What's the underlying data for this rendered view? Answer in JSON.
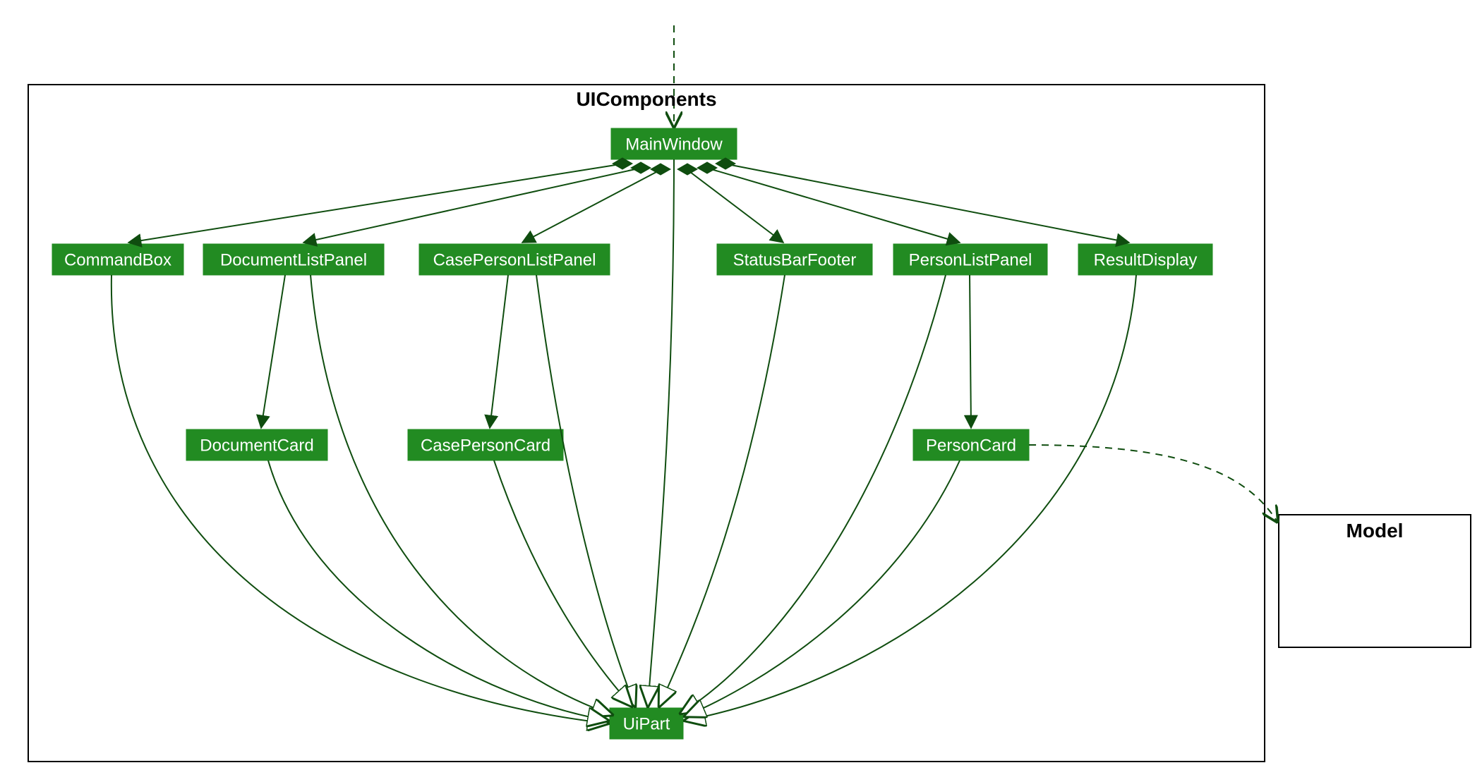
{
  "diagram": {
    "package_title": "UIComponents",
    "external_title": "Model",
    "nodes": {
      "MainWindow": "MainWindow",
      "CommandBox": "CommandBox",
      "DocumentListPanel": "DocumentListPanel",
      "CasePersonListPanel": "CasePersonListPanel",
      "StatusBarFooter": "StatusBarFooter",
      "PersonListPanel": "PersonListPanel",
      "ResultDisplay": "ResultDisplay",
      "DocumentCard": "DocumentCard",
      "CasePersonCard": "CasePersonCard",
      "PersonCard": "PersonCard",
      "UiPart": "UiPart"
    }
  },
  "chart_data": {
    "type": "uml-class-diagram",
    "packages": [
      {
        "name": "UIComponents",
        "classes": [
          "MainWindow",
          "CommandBox",
          "DocumentListPanel",
          "CasePersonListPanel",
          "StatusBarFooter",
          "PersonListPanel",
          "ResultDisplay",
          "DocumentCard",
          "CasePersonCard",
          "PersonCard",
          "UiPart"
        ]
      },
      {
        "name": "Model",
        "classes": []
      }
    ],
    "edges": [
      {
        "from": "(external)",
        "to": "MainWindow",
        "kind": "dependency"
      },
      {
        "from": "MainWindow",
        "to": "CommandBox",
        "kind": "composition"
      },
      {
        "from": "MainWindow",
        "to": "DocumentListPanel",
        "kind": "composition"
      },
      {
        "from": "MainWindow",
        "to": "CasePersonListPanel",
        "kind": "composition"
      },
      {
        "from": "MainWindow",
        "to": "StatusBarFooter",
        "kind": "composition"
      },
      {
        "from": "MainWindow",
        "to": "PersonListPanel",
        "kind": "composition"
      },
      {
        "from": "MainWindow",
        "to": "ResultDisplay",
        "kind": "composition"
      },
      {
        "from": "DocumentListPanel",
        "to": "DocumentCard",
        "kind": "association"
      },
      {
        "from": "CasePersonListPanel",
        "to": "CasePersonCard",
        "kind": "association"
      },
      {
        "from": "PersonListPanel",
        "to": "PersonCard",
        "kind": "association"
      },
      {
        "from": "MainWindow",
        "to": "UiPart",
        "kind": "generalization"
      },
      {
        "from": "CommandBox",
        "to": "UiPart",
        "kind": "generalization"
      },
      {
        "from": "DocumentListPanel",
        "to": "UiPart",
        "kind": "generalization"
      },
      {
        "from": "CasePersonListPanel",
        "to": "UiPart",
        "kind": "generalization"
      },
      {
        "from": "StatusBarFooter",
        "to": "UiPart",
        "kind": "generalization"
      },
      {
        "from": "PersonListPanel",
        "to": "UiPart",
        "kind": "generalization"
      },
      {
        "from": "ResultDisplay",
        "to": "UiPart",
        "kind": "generalization"
      },
      {
        "from": "DocumentCard",
        "to": "UiPart",
        "kind": "generalization"
      },
      {
        "from": "CasePersonCard",
        "to": "UiPart",
        "kind": "generalization"
      },
      {
        "from": "PersonCard",
        "to": "UiPart",
        "kind": "generalization"
      },
      {
        "from": "PersonCard",
        "to": "Model",
        "kind": "dependency"
      }
    ]
  }
}
